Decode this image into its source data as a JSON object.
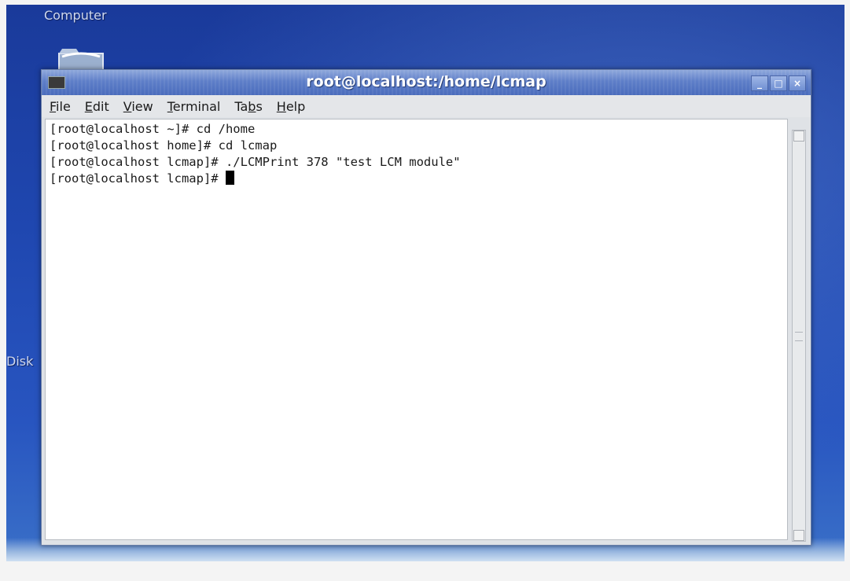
{
  "desktop": {
    "icons": [
      {
        "label": "Computer",
        "icon": "computer-icon"
      },
      {
        "label": "",
        "icon": "folder-icon"
      }
    ],
    "side_label": "Disk",
    "colors": {
      "background": "#1f47b0",
      "label": "#cfd8ee"
    }
  },
  "window": {
    "title": "root@localhost:/home/lcmap",
    "icon": "terminal-icon",
    "controls": {
      "minimize": "_",
      "maximize": "□",
      "close": "×"
    },
    "colors": {
      "titlebar": "#5e7ec8",
      "title_text": "#ffffff"
    }
  },
  "menubar": {
    "items": [
      {
        "pre": "",
        "ul": "F",
        "post": "ile"
      },
      {
        "pre": "",
        "ul": "E",
        "post": "dit"
      },
      {
        "pre": "",
        "ul": "V",
        "post": "iew"
      },
      {
        "pre": "",
        "ul": "T",
        "post": "erminal"
      },
      {
        "pre": "Ta",
        "ul": "b",
        "post": "s"
      },
      {
        "pre": "",
        "ul": "H",
        "post": "elp"
      }
    ]
  },
  "terminal": {
    "lines": [
      "[root@localhost ~]# cd /home",
      "[root@localhost home]# cd lcmap",
      "[root@localhost lcmap]# ./LCMPrint 378 \"test LCM module\"",
      "[root@localhost lcmap]# "
    ],
    "colors": {
      "background": "#ffffff",
      "text": "#1a1a1a",
      "cursor": "#000000"
    }
  }
}
